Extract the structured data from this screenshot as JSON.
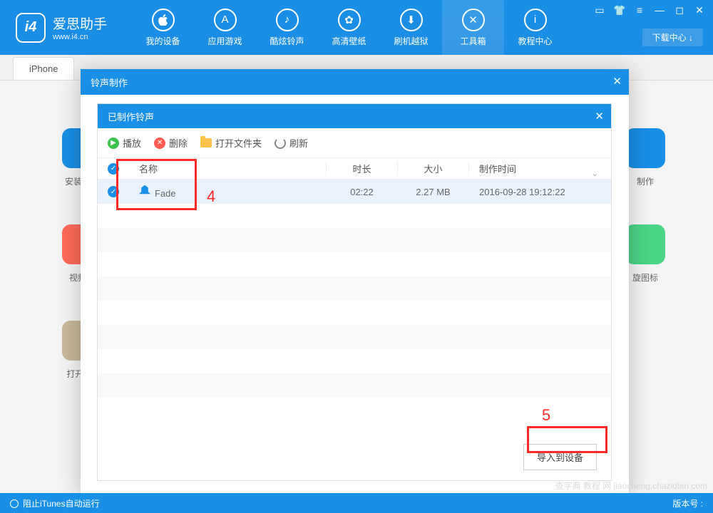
{
  "app": {
    "name": "爱思助手",
    "url": "www.i4.cn",
    "logo_text": "i4"
  },
  "nav": [
    {
      "label": "我的设备",
      "glyph": ""
    },
    {
      "label": "应用游戏",
      "glyph": "A"
    },
    {
      "label": "酷炫铃声",
      "glyph": "♪"
    },
    {
      "label": "高清壁纸",
      "glyph": "✿"
    },
    {
      "label": "刷机越狱",
      "glyph": "⬇"
    },
    {
      "label": "工具箱",
      "glyph": "✕",
      "active": true
    },
    {
      "label": "教程中心",
      "glyph": "i"
    }
  ],
  "download_center": "下载中心 ↓",
  "tabs": {
    "iphone": "iPhone"
  },
  "tiles": {
    "left": [
      {
        "label": "安装爱思",
        "cls": "tile-blue"
      },
      {
        "label": "视频转",
        "cls": "tile-red"
      },
      {
        "label": "打开 SS",
        "cls": "tile-tan"
      }
    ],
    "right": [
      {
        "label": "制作",
        "cls": "tile-blue"
      },
      {
        "label": "旋图标",
        "cls": "tile-green"
      }
    ]
  },
  "outer_dialog": {
    "title": "铃声制作"
  },
  "inner_dialog": {
    "title": "已制作铃声",
    "toolbar": {
      "play": "播放",
      "delete": "删除",
      "open_folder": "打开文件夹",
      "refresh": "刷新"
    },
    "columns": {
      "name": "名称",
      "duration": "时长",
      "size": "大小",
      "mtime": "制作时间"
    },
    "rows": [
      {
        "name": "Fade",
        "duration": "02:22",
        "size": "2.27 MB",
        "mtime": "2016-09-28 19:12:22",
        "checked": true
      }
    ],
    "import_btn": "导入到设备"
  },
  "annotations": {
    "num4": "4",
    "num5": "5"
  },
  "status": {
    "itunes": "阻止iTunes自动运行",
    "version_label": "版本号 :"
  },
  "watermark": "查字典  教程 网\njiaocheng.chazidian.com"
}
